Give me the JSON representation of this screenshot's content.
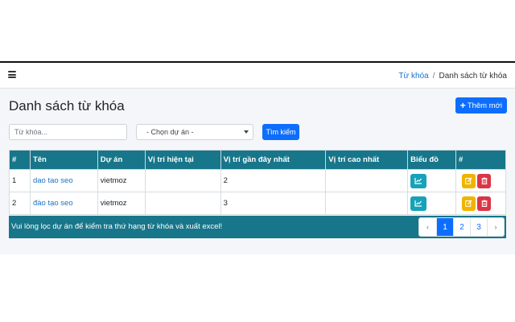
{
  "breadcrumb": {
    "parent": "Từ khóa",
    "separator": "/",
    "current": "Danh sách từ khóa"
  },
  "page": {
    "title": "Danh sách từ khóa",
    "add_button": "Thêm mới"
  },
  "filters": {
    "keyword_placeholder": "Từ khóa...",
    "project_select": "- Chọn dự án -",
    "search_button": "Tìm kiếm"
  },
  "table": {
    "headers": [
      "#",
      "Tên",
      "Dự án",
      "Vị trí hiện tại",
      "Vị trí gần đây nhất",
      "Vị trí cao nhất",
      "Biểu đồ",
      "#"
    ],
    "rows": [
      {
        "index": "1",
        "name": "dao tao seo",
        "project": "vietmoz",
        "current": "",
        "recent": "2",
        "highest": ""
      },
      {
        "index": "2",
        "name": "đào tạo seo",
        "project": "vietmoz",
        "current": "",
        "recent": "3",
        "highest": ""
      }
    ]
  },
  "footer": {
    "message": "Vui lòng lọc dự án để kiểm tra thứ hạng từ khóa và xuất excel!"
  },
  "pagination": {
    "prev": "‹",
    "pages": [
      "1",
      "2",
      "3"
    ],
    "active": "1",
    "next": "›"
  },
  "colors": {
    "primary": "#0d6efd",
    "header_teal": "#17768a",
    "info": "#17a2b8",
    "warning": "#f0b400",
    "danger": "#dc3545"
  }
}
